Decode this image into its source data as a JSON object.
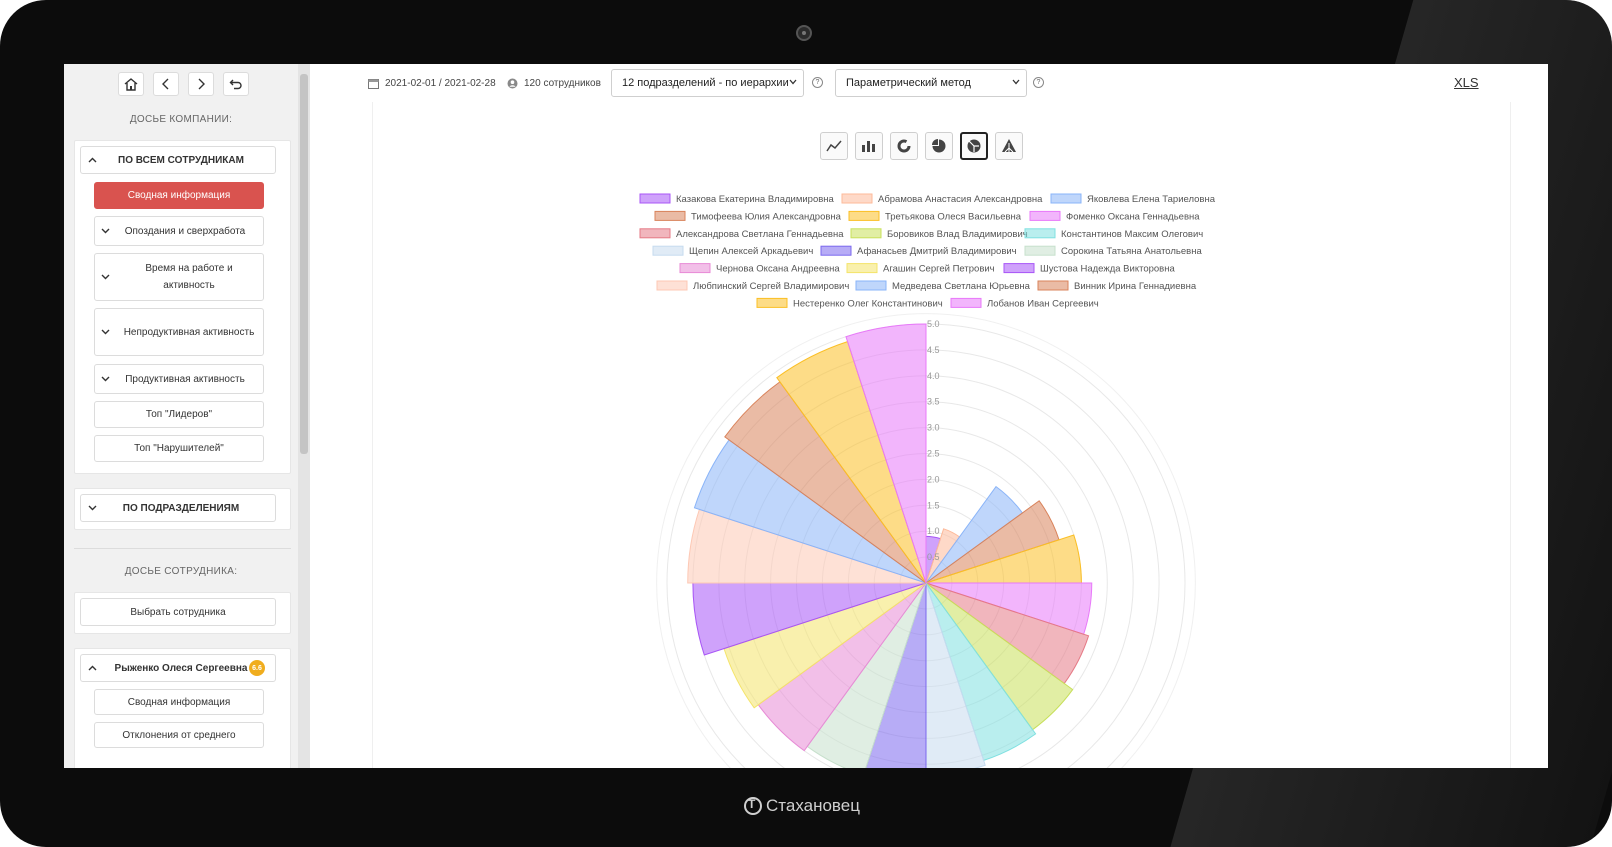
{
  "brand": "Стахановец",
  "sidebar": {
    "company_title": "ДОСЬЕ КОМПАНИИ:",
    "all_employees": "ПО ВСЕМ СОТРУДНИКАМ",
    "items": [
      "Сводная информация",
      "Опоздания и сверхработа",
      "Время на работе и активность",
      "Непродуктивная активность",
      "Продуктивная активность",
      "Топ \"Лидеров\"",
      "Топ \"Нарушителей\""
    ],
    "by_departments": "ПО ПОДРАЗДЕЛЕНИЯМ",
    "employee_title": "ДОСЬЕ СОТРУДНИКА:",
    "select_employee": "Выбрать сотрудника",
    "employee_name": "Рыженко Олеся Сергеевна",
    "employee_badge": "6.6",
    "employee_items": [
      "Сводная информация",
      "Отклонения от среднего"
    ]
  },
  "topbar": {
    "date_range": "2021-02-01 / 2021-02-28",
    "employees_count": "120 сотрудников",
    "departments_select": "12 подразделений - по иерархии",
    "method_select": "Параметрический метод",
    "xls": "XLS"
  },
  "chart_types": [
    "line-chart-icon",
    "bar-chart-icon",
    "doughnut-chart-icon",
    "pie-chart-icon",
    "polar-area-chart-icon",
    "radar-chart-icon"
  ],
  "chart_data": {
    "type": "polar-area",
    "r_ticks": [
      "0.5",
      "1.0",
      "1.5",
      "2.0",
      "2.5",
      "3.0",
      "3.5",
      "4.0",
      "4.5",
      "5.0"
    ],
    "r_max": 5.0,
    "series": [
      {
        "name": "Казакова Екатерина Владимировна",
        "value": 0.9,
        "color": "#a855f7"
      },
      {
        "name": "Абрамова Анастасия Александровна",
        "value": 1.1,
        "color": "#fdba9a"
      },
      {
        "name": "Яковлева Елена Тариеловна",
        "value": 2.3,
        "color": "#8ab4f8"
      },
      {
        "name": "Тимофеева Юлия Александровна",
        "value": 2.7,
        "color": "#d9835b"
      },
      {
        "name": "Третьякова Олеся Васильевна",
        "value": 3.0,
        "color": "#fbbf24"
      },
      {
        "name": "Фоменко Оксана Геннадьевна",
        "value": 3.2,
        "color": "#e879f9"
      },
      {
        "name": "Александрова Светлана Геннадьевна",
        "value": 3.3,
        "color": "#e57a86"
      },
      {
        "name": "Боровиков Влад Владимирович",
        "value": 3.5,
        "color": "#c8e05a"
      },
      {
        "name": "Константинов Максим Олегович",
        "value": 3.6,
        "color": "#7fe0e0"
      },
      {
        "name": "Щепин Алексей Аркадьевич",
        "value": 3.7,
        "color": "#c6dbef"
      },
      {
        "name": "Афанасьев Дмитрий Владимирович",
        "value": 3.8,
        "color": "#7b68ee"
      },
      {
        "name": "Сорокина Татьяна Анатольевна",
        "value": 3.9,
        "color": "#c7e0cc"
      },
      {
        "name": "Чернова Оксана Андреевна",
        "value": 4.0,
        "color": "#e88ad6"
      },
      {
        "name": "Агашин Сергей Петрович",
        "value": 4.1,
        "color": "#f4e46a"
      },
      {
        "name": "Шустова Надежда Викторовна",
        "value": 4.5,
        "color": "#a855f7"
      },
      {
        "name": "Любпинский Сергей Владимирович",
        "value": 4.6,
        "color": "#fdc8b4"
      },
      {
        "name": "Медведева Светлана Юрьевна",
        "value": 4.7,
        "color": "#8ab4f8"
      },
      {
        "name": "Винник Ирина Геннадиевна",
        "value": 4.8,
        "color": "#d9835b"
      },
      {
        "name": "Нестеренко Олег Константинович",
        "value": 4.9,
        "color": "#fbbf24"
      },
      {
        "name": "Лобанов Иван Сергеевич",
        "value": 5.0,
        "color": "#e879f9"
      }
    ]
  }
}
